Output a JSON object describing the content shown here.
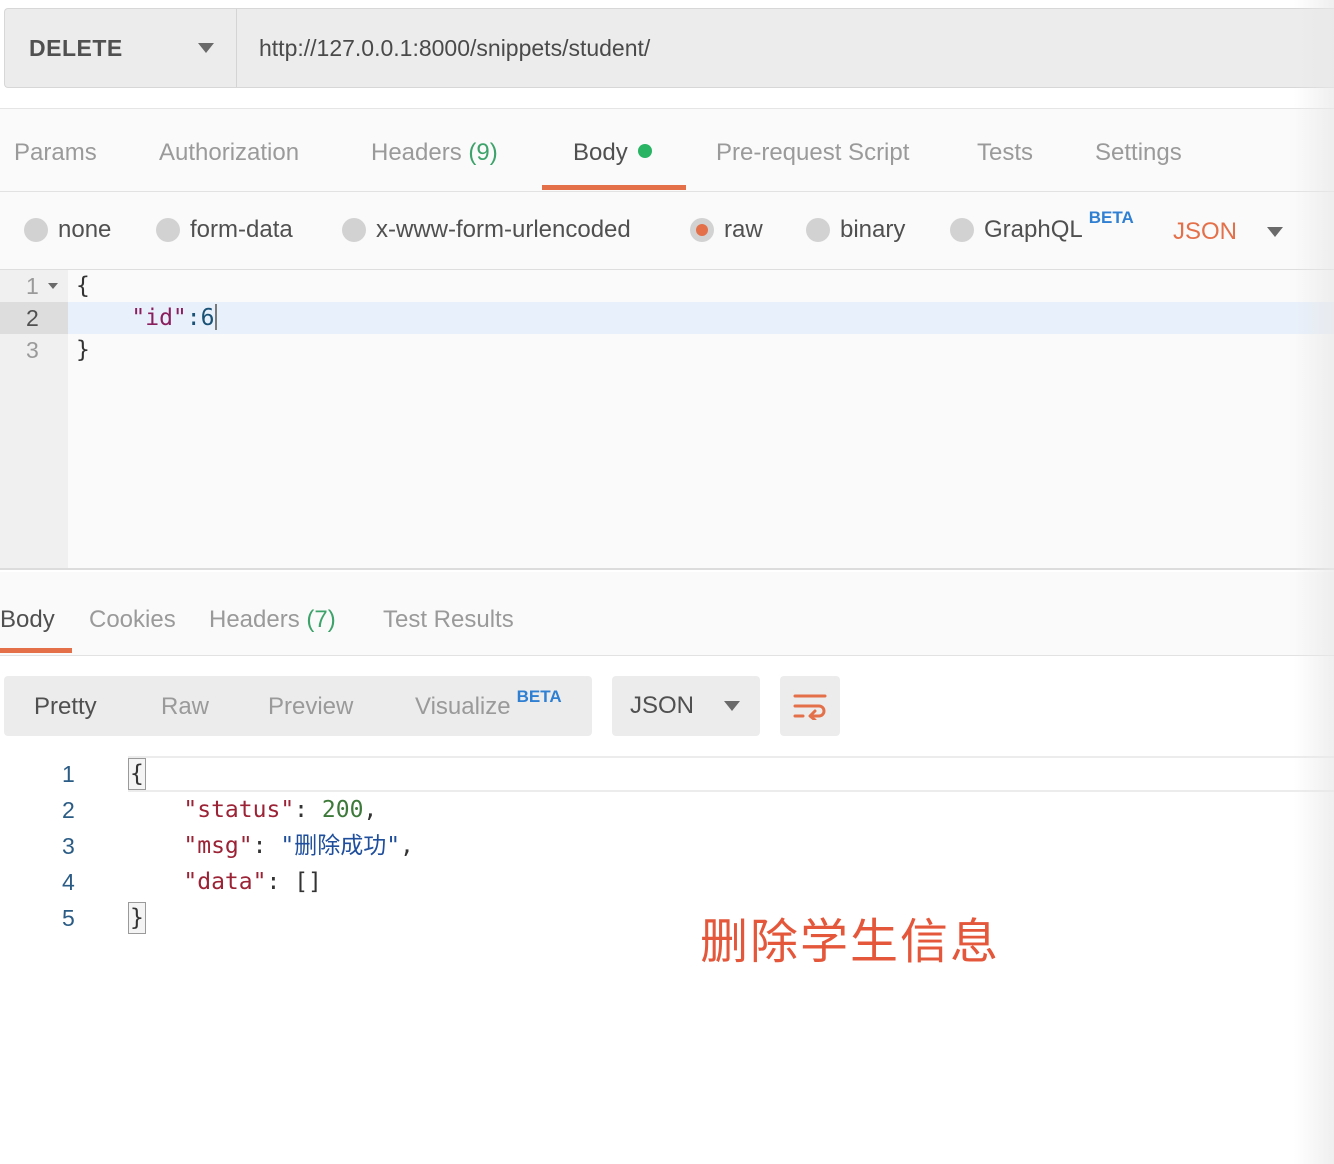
{
  "request": {
    "method": "DELETE",
    "url": "http://127.0.0.1:8000/snippets/student/"
  },
  "request_tabs": [
    {
      "label": "Params"
    },
    {
      "label": "Authorization"
    },
    {
      "label": "Headers",
      "count": "(9)"
    },
    {
      "label": "Body",
      "active": true
    },
    {
      "label": "Pre-request Script"
    },
    {
      "label": "Tests"
    },
    {
      "label": "Settings"
    }
  ],
  "body_types": {
    "options": [
      "none",
      "form-data",
      "x-www-form-urlencoded",
      "raw",
      "binary",
      "GraphQL"
    ],
    "selected": "raw",
    "graphql_badge": "BETA",
    "format": "JSON"
  },
  "request_editor": {
    "line_numbers": [
      "1",
      "2",
      "3"
    ],
    "lines": [
      "{",
      "\"id\"",
      ":6",
      "}"
    ],
    "active_line": 2
  },
  "response_tabs": [
    {
      "label": "Body",
      "active": true
    },
    {
      "label": "Cookies"
    },
    {
      "label": "Headers",
      "count": "(7)"
    },
    {
      "label": "Test Results"
    }
  ],
  "response_view": {
    "modes": [
      "Pretty",
      "Raw",
      "Preview",
      "Visualize"
    ],
    "visualize_badge": "BETA",
    "active_mode": "Pretty",
    "format": "JSON"
  },
  "response_body": {
    "line_numbers": [
      "1",
      "2",
      "3",
      "4",
      "5"
    ],
    "open_brace": "{",
    "close_brace": "}",
    "status_key": "\"status\"",
    "status_value": "200",
    "msg_key": "\"msg\"",
    "msg_value": "\"删除成功\"",
    "data_key": "\"data\"",
    "data_value": "[]"
  },
  "annotation": "删除学生信息",
  "colors": {
    "accent": "#e4704a",
    "active_dot": "#28b463",
    "beta": "#2f7fd3"
  }
}
